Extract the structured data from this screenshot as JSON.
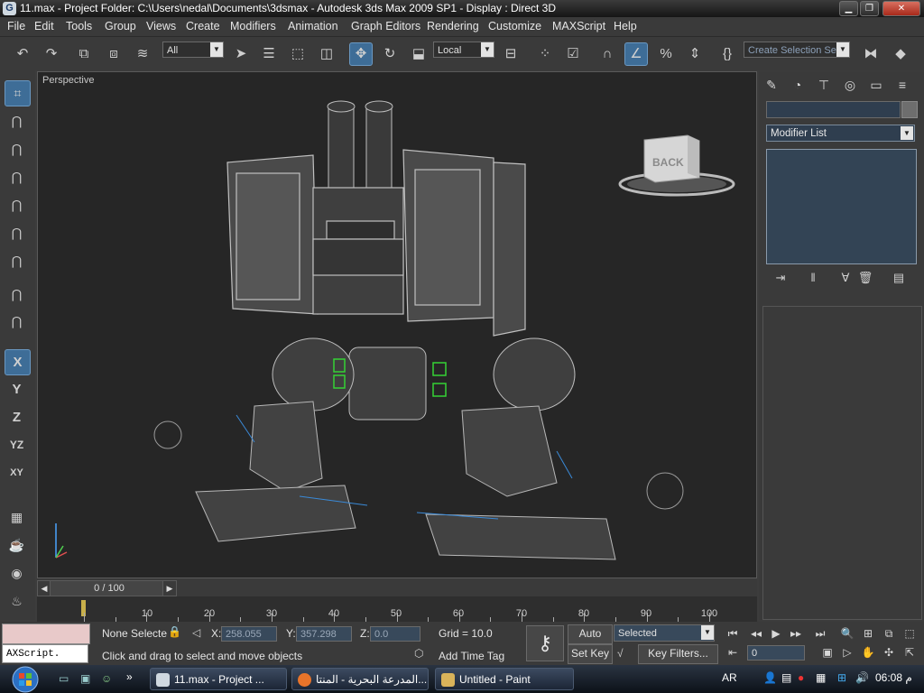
{
  "title": {
    "text": "11.max    - Project Folder: C:\\Users\\nedal\\Documents\\3dsmax     - Autodesk 3ds Max  2009 SP1     - Display : Direct 3D",
    "app_icon": "3ds-max-icon",
    "controls": [
      "minimize-icon",
      "maximize-icon",
      "close-icon"
    ]
  },
  "menu": [
    "File",
    "Edit",
    "Tools",
    "Group",
    "Views",
    "Create",
    "Modifiers",
    "Animation",
    "Graph Editors",
    "Rendering",
    "Customize",
    "MAXScript",
    "Help"
  ],
  "toolbar": {
    "selection_filter": "All",
    "ref_coord": "Local",
    "selection_set_placeholder": "Create Selection Se",
    "icons": [
      "undo-icon",
      "redo-icon",
      "link-icon",
      "unlink-icon",
      "bind-space-warp-icon",
      "select-object-icon",
      "select-by-name-icon",
      "rect-selection-region-icon",
      "window-crossing-icon",
      "select-move-icon",
      "select-rotate-icon",
      "select-scale-icon",
      "pivot-center-icon",
      "select-manipulate-icon",
      "keyboard-shortcut-icon",
      "snaps-toggle-icon",
      "angle-snap-icon",
      "percent-snap-icon",
      "spinner-snap-icon",
      "edit-named-sets-icon",
      "mirror-icon",
      "align-icon"
    ]
  },
  "left_toolbar": {
    "axes": [
      "X",
      "Y",
      "Z",
      "YZ",
      "XY"
    ]
  },
  "viewport": {
    "label": "Perspective",
    "viewcube_label": "BACK"
  },
  "command_panel": {
    "tabs": [
      "create-tab-icon",
      "modify-tab-icon",
      "hierarchy-tab-icon",
      "motion-tab-icon",
      "display-tab-icon",
      "utilities-tab-icon"
    ],
    "modifier_list": "Modifier List",
    "stack_buttons": [
      "pin-stack-icon",
      "show-end-result-icon",
      "make-unique-icon",
      "remove-modifier-icon",
      "configure-modifier-sets-icon"
    ]
  },
  "time": {
    "slider_label": "0 / 100",
    "ticks": [
      "10",
      "20",
      "30",
      "40",
      "50",
      "60",
      "70",
      "80",
      "90",
      "100"
    ]
  },
  "status": {
    "maxscript_prompt": "AXScript.",
    "selection": "None Selecte",
    "x_label": "X:",
    "x_value": "258.055",
    "y_label": "Y:",
    "y_value": "357.298",
    "z_label": "Z:",
    "z_value": "0.0",
    "grid": "Grid = 10.0",
    "prompt": "Click and drag to select and move objects",
    "add_time_tag": "Add Time Tag",
    "auto_key": "Auto Key",
    "set_key": "Set Key",
    "key_mode": "Selected",
    "key_filters": "Key Filters...",
    "frame": "0"
  },
  "taskbar": {
    "tasks": [
      {
        "label": "11.max    - Project ...",
        "icon": "3ds-max-icon"
      },
      {
        "label": "المدرعة البحرية - المنتا...",
        "icon": "firefox-icon"
      },
      {
        "label": "Untitled - Paint",
        "icon": "paint-icon"
      }
    ],
    "lang": "AR",
    "clock": "06:08 م"
  }
}
